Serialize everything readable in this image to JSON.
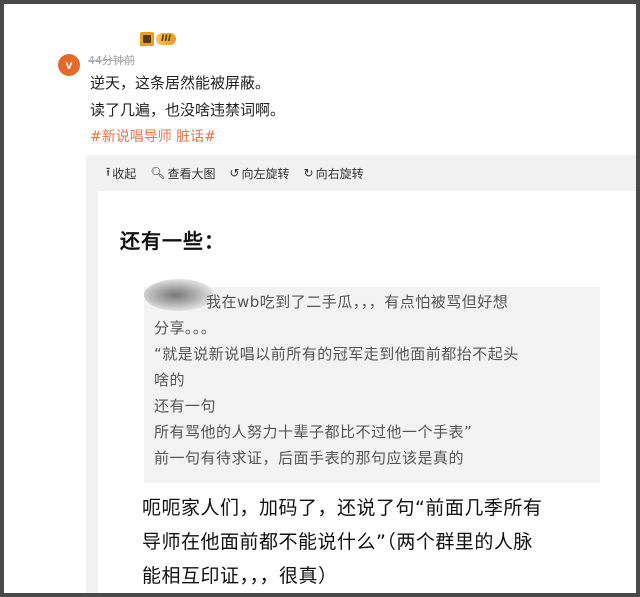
{
  "post": {
    "level_badge": "III",
    "time": "44分钟前",
    "lines": [
      "逆天，这条居然能被屏蔽。",
      "读了几遍，也没啥违禁词啊。"
    ],
    "hashtags": "#新说唱导师 脏话#"
  },
  "toolbar": {
    "collapse": "收起",
    "view_large": "查看大图",
    "rotate_left": "向左旋转",
    "rotate_right": "向右旋转"
  },
  "image": {
    "heading": "还有一些：",
    "quote_lines": [
      "我在wb吃到了二手瓜，，，有点怕被骂但好想",
      "分享。。。",
      "“就是说新说唱以前所有的冠军走到他面前都抬不起头",
      "啥的",
      "还有一句",
      "所有骂他的人努力十辈子都比不过他一个手表”",
      "前一句有待求证，后面手表的那句应该是真的"
    ],
    "body_lines": [
      "呃呃家人们，加码了，还说了句“前面几季所有",
      "导师在他面前都不能说什么”（两个群里的人脉",
      "能相互印证，，，很真）"
    ]
  },
  "colors": {
    "hashtag": "#eb7350",
    "avatar": "#e46a2c",
    "frame": "#4a4a4a"
  },
  "icons": {
    "avatar": "weibo-avatar-icon",
    "vip": "vip-crown-icon",
    "collapse": "arrow-up-icon",
    "view_large": "magnifier-icon",
    "rotate_left": "rotate-left-icon",
    "rotate_right": "rotate-right-icon"
  }
}
